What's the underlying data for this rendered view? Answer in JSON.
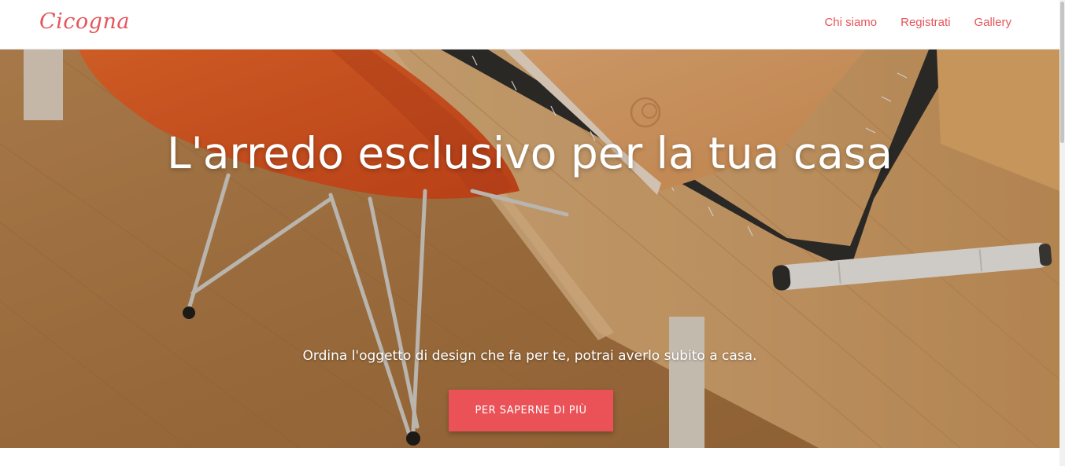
{
  "navbar": {
    "brand": "Cicogna",
    "links": [
      {
        "label": "Chi siamo"
      },
      {
        "label": "Registrati"
      },
      {
        "label": "Gallery"
      }
    ]
  },
  "hero": {
    "title": "L'arredo esclusivo per la tua casa",
    "subtitle": "Ordina l'oggetto di design che fa per te, potrai averlo subito a casa.",
    "cta_label": "PER SAPERNE DI PIÙ"
  },
  "colors": {
    "accent": "#e5555b",
    "button": "#ea5257"
  }
}
